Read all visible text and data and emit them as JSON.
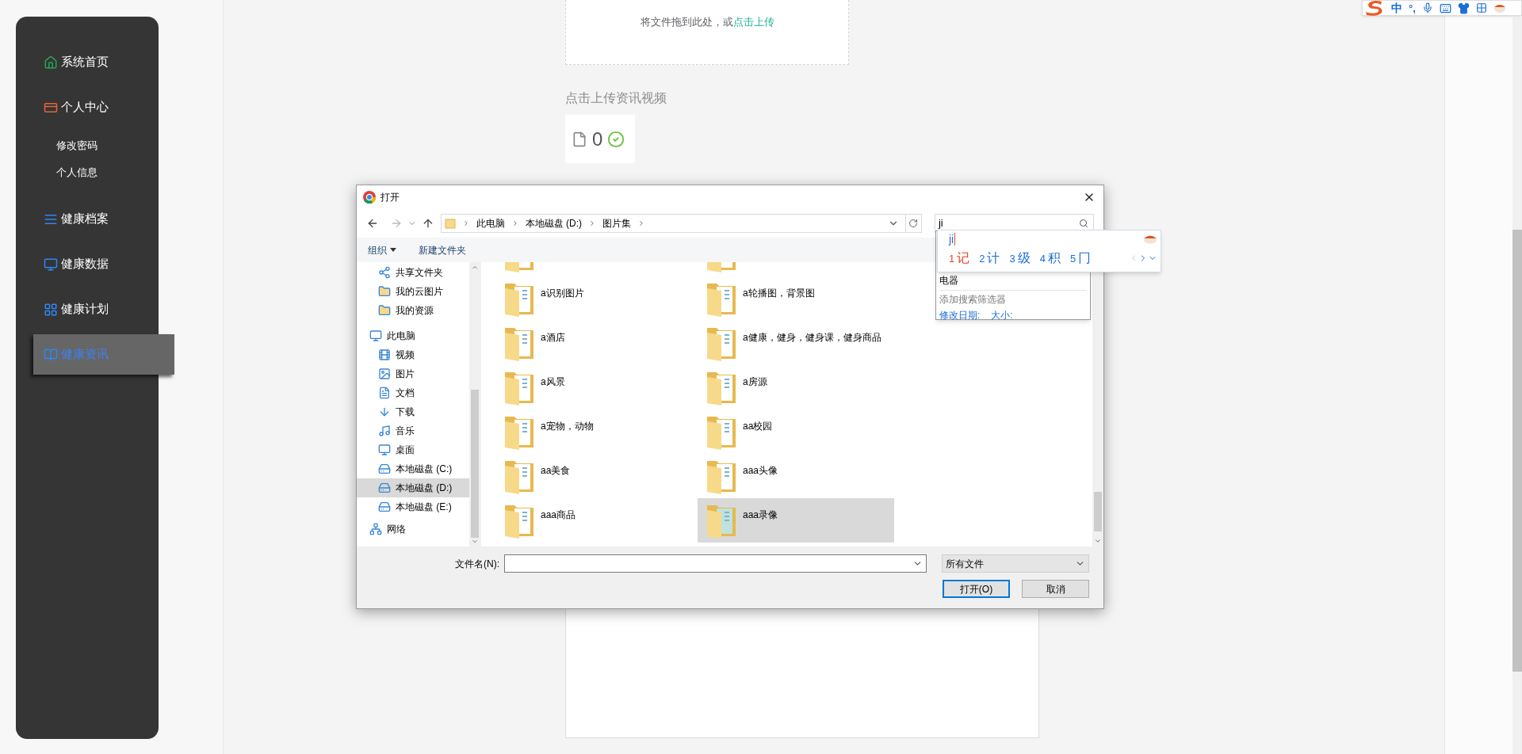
{
  "ime_toolbar": {
    "mode": "中",
    "punctuation": "°,"
  },
  "sidebar": {
    "items": [
      {
        "label": "系统首页",
        "selected": false
      },
      {
        "label": "个人中心",
        "selected": false,
        "children": [
          {
            "label": "修改密码",
            "selected": false
          },
          {
            "label": "个人信息",
            "selected": false
          }
        ]
      },
      {
        "label": "健康档案",
        "selected": false
      },
      {
        "label": "健康数据",
        "selected": false
      },
      {
        "label": "健康计划",
        "selected": false
      },
      {
        "label": "健康资讯",
        "selected": true
      }
    ]
  },
  "upload": {
    "hint": "将文件拖到此处，或",
    "link": "点击上传"
  },
  "section_title": "点击上传资讯视频",
  "file_card": {
    "count": "0",
    "uploaded": true
  },
  "dialog": {
    "title": "打开",
    "path": [
      "此电脑",
      "本地磁盘 (D:)",
      "图片集"
    ],
    "search": {
      "value": "ji"
    },
    "toolbar": [
      {
        "label": "组织",
        "dropdown": true
      },
      {
        "label": "新建文件夹",
        "dropdown": false
      }
    ],
    "quick_access": [
      {
        "label": "共享文件夹",
        "selected": false
      },
      {
        "label": "我的云图片",
        "selected": false
      },
      {
        "label": "我的资源",
        "selected": false
      }
    ],
    "nav": [
      {
        "label": "此电脑",
        "selected": false,
        "children": [
          {
            "label": "视频",
            "selected": false
          },
          {
            "label": "图片",
            "selected": false
          },
          {
            "label": "文档",
            "selected": false
          },
          {
            "label": "下载",
            "selected": false
          },
          {
            "label": "音乐",
            "selected": false
          },
          {
            "label": "桌面",
            "selected": false
          },
          {
            "label": "本地磁盘 (C:)",
            "selected": false
          },
          {
            "label": "本地磁盘 (D:)",
            "selected": true
          },
          {
            "label": "本地磁盘 (E:)",
            "selected": false
          }
        ]
      },
      {
        "label": "网络",
        "selected": false
      }
    ],
    "files": [
      {
        "name": "a识别图片",
        "selected": false
      },
      {
        "name": "a轮播图，背景图",
        "selected": false
      },
      {
        "name": "a酒店",
        "selected": false
      },
      {
        "name": "a健康，健身，健身课，健身商品",
        "selected": false
      },
      {
        "name": "a风景",
        "selected": false
      },
      {
        "name": "a房源",
        "selected": false
      },
      {
        "name": "a宠物，动物",
        "selected": false
      },
      {
        "name": "aa校园",
        "selected": false
      },
      {
        "name": "aa美食",
        "selected": false
      },
      {
        "name": "aaa头像",
        "selected": false
      },
      {
        "name": "aaa商品",
        "selected": false
      },
      {
        "name": "aaa录像",
        "selected": true
      }
    ],
    "filename_label": "文件名(N):",
    "filter": "所有文件",
    "buttons": [
      {
        "label": "打开(O)",
        "default": true
      },
      {
        "label": "取消",
        "default": false
      }
    ]
  },
  "search_suggestions": {
    "items": [
      "电器"
    ],
    "filter_title": "添加搜索筛选器",
    "filters": [
      "修改日期:",
      "大小:"
    ]
  },
  "ime": {
    "composition": "ji",
    "candidates": [
      {
        "index": "1",
        "text": "记",
        "selected": true
      },
      {
        "index": "2",
        "text": "计",
        "selected": false
      },
      {
        "index": "3",
        "text": "级",
        "selected": false
      },
      {
        "index": "4",
        "text": "积",
        "selected": false
      },
      {
        "index": "5",
        "text": "冂",
        "selected": false
      }
    ]
  }
}
